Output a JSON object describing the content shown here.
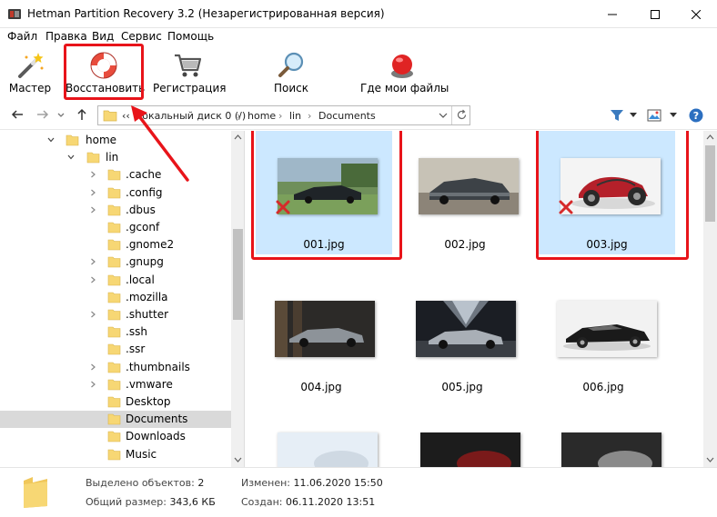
{
  "window": {
    "title": "Hetman Partition Recovery 3.2 (Незарегистрированная версия)"
  },
  "menu": [
    "Файл",
    "Правка",
    "Вид",
    "Сервис",
    "Помощь"
  ],
  "toolbar": {
    "wizard": "Мастер",
    "restore": "Восстановить",
    "register": "Регистрация",
    "search": "Поиск",
    "where_files": "Где мои файлы"
  },
  "address": {
    "prefix": "‹‹",
    "segments": [
      "Локальный диск 0 (/)",
      "home",
      "lin",
      "Documents"
    ]
  },
  "tree": {
    "items": [
      {
        "label": "home",
        "level": 0,
        "expand": "expanded"
      },
      {
        "label": "lin",
        "level": 1,
        "expand": "expanded"
      },
      {
        "label": ".cache",
        "level": 2,
        "expand": "collapsed"
      },
      {
        "label": ".config",
        "level": 2,
        "expand": "collapsed"
      },
      {
        "label": ".dbus",
        "level": 2,
        "expand": "collapsed"
      },
      {
        "label": ".gconf",
        "level": 2,
        "expand": "none"
      },
      {
        "label": ".gnome2",
        "level": 2,
        "expand": "none"
      },
      {
        "label": ".gnupg",
        "level": 2,
        "expand": "collapsed"
      },
      {
        "label": ".local",
        "level": 2,
        "expand": "collapsed"
      },
      {
        "label": ".mozilla",
        "level": 2,
        "expand": "none"
      },
      {
        "label": ".shutter",
        "level": 2,
        "expand": "collapsed"
      },
      {
        "label": ".ssh",
        "level": 2,
        "expand": "none"
      },
      {
        "label": ".ssr",
        "level": 2,
        "expand": "none"
      },
      {
        "label": ".thumbnails",
        "level": 2,
        "expand": "collapsed"
      },
      {
        "label": ".vmware",
        "level": 2,
        "expand": "collapsed"
      },
      {
        "label": "Desktop",
        "level": 2,
        "expand": "none"
      },
      {
        "label": "Documents",
        "level": 2,
        "expand": "none",
        "selected": true
      },
      {
        "label": "Downloads",
        "level": 2,
        "expand": "none"
      },
      {
        "label": "Music",
        "level": 2,
        "expand": "none"
      }
    ]
  },
  "files": [
    {
      "name": "001.jpg",
      "selected": true,
      "deleted": true,
      "scene": "car-dark-garden"
    },
    {
      "name": "002.jpg",
      "selected": false,
      "deleted": false,
      "scene": "car-muscle"
    },
    {
      "name": "003.jpg",
      "selected": true,
      "deleted": true,
      "scene": "car-concept-white"
    },
    {
      "name": "004.jpg",
      "selected": false,
      "deleted": false,
      "scene": "car-silver-dark"
    },
    {
      "name": "005.jpg",
      "selected": false,
      "deleted": false,
      "scene": "car-silver-tunnel"
    },
    {
      "name": "006.jpg",
      "selected": false,
      "deleted": false,
      "scene": "car-black-white"
    }
  ],
  "status": {
    "selected_label": "Выделено объектов:",
    "selected_value": "2",
    "size_label": "Общий размер:",
    "size_value": "343,6 КБ",
    "modified_label": "Изменен:",
    "modified_value": "11.06.2020 15:50",
    "created_label": "Создан:",
    "created_value": "06.11.2020 13:51"
  },
  "colors": {
    "selection": "#cce8ff",
    "highlight_frame": "#e8141a",
    "folder": "#f7d774",
    "tree_selected": "#d9d9d9"
  }
}
